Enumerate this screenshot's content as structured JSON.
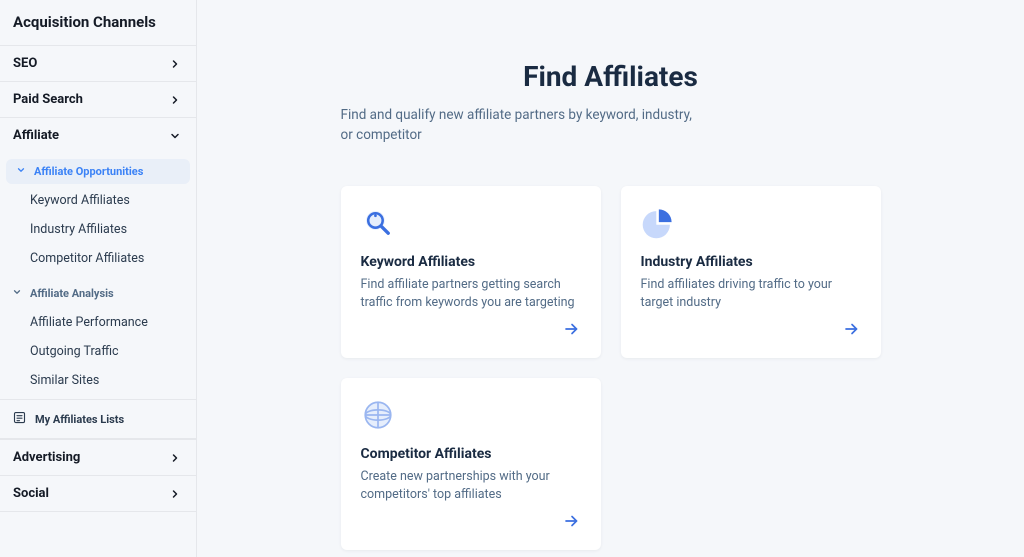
{
  "sidebar": {
    "title": "Acquisition Channels",
    "items": [
      {
        "label": "SEO",
        "expanded": false
      },
      {
        "label": "Paid Search",
        "expanded": false
      },
      {
        "label": "Affiliate",
        "expanded": true
      },
      {
        "label": "Advertising",
        "expanded": false
      },
      {
        "label": "Social",
        "expanded": false
      }
    ],
    "affiliate": {
      "opportunities": {
        "label": "Affiliate Opportunities",
        "items": [
          "Keyword Affiliates",
          "Industry Affiliates",
          "Competitor Affiliates"
        ]
      },
      "analysis": {
        "label": "Affiliate Analysis",
        "items": [
          "Affiliate Performance",
          "Outgoing Traffic",
          "Similar Sites"
        ]
      },
      "lists_label": "My Affiliates Lists"
    }
  },
  "main": {
    "title": "Find Affiliates",
    "subtitle": "Find and qualify new affiliate partners by keyword, industry, or competitor",
    "cards": [
      {
        "title": "Keyword Affiliates",
        "desc": "Find affiliate partners getting search traffic from keywords you are targeting",
        "icon": "magnifier"
      },
      {
        "title": "Industry Affiliates",
        "desc": "Find affiliates driving traffic to your target industry",
        "icon": "pie"
      },
      {
        "title": "Competitor Affiliates",
        "desc": "Create new partnerships with your competitors' top affiliates",
        "icon": "globe"
      }
    ]
  }
}
